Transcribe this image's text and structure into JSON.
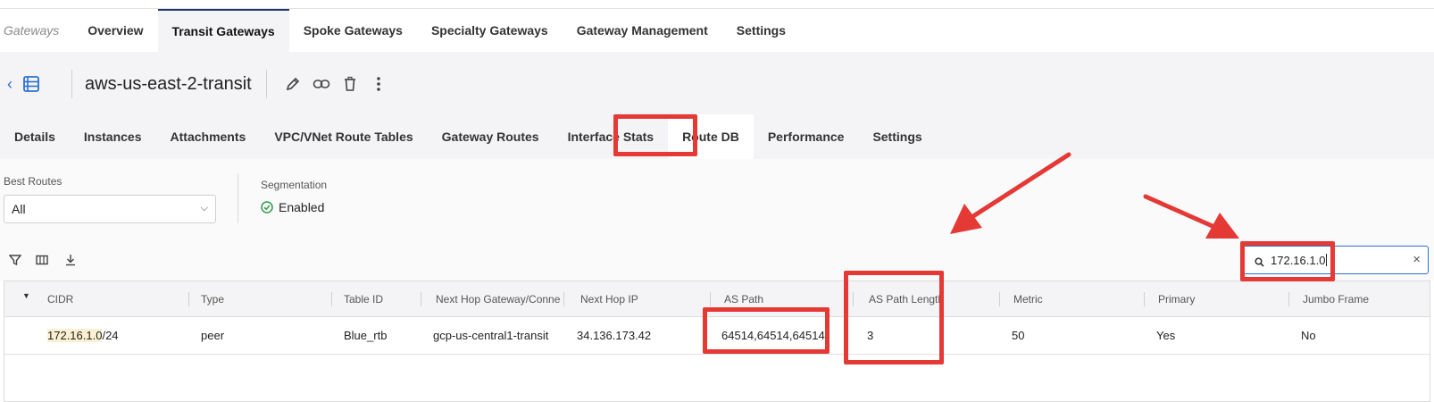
{
  "topnav": {
    "crumb": "Gateways",
    "tabs": [
      "Overview",
      "Transit Gateways",
      "Spoke Gateways",
      "Specialty Gateways",
      "Gateway Management",
      "Settings"
    ],
    "active_tab": "Transit Gateways"
  },
  "gateway": {
    "name": "aws-us-east-2-transit",
    "actions": [
      "edit-icon",
      "link-icon",
      "trash-icon",
      "more-vertical-icon"
    ]
  },
  "subtabs": {
    "items": [
      "Details",
      "Instances",
      "Attachments",
      "VPC/VNet Route Tables",
      "Gateway Routes",
      "Interface Stats",
      "Route DB",
      "Performance",
      "Settings"
    ],
    "active": "Route DB"
  },
  "filters": {
    "best_routes_label": "Best Routes",
    "best_routes_value": "All",
    "segmentation_label": "Segmentation",
    "segmentation_value": "Enabled"
  },
  "toolbar": {
    "icons": [
      "filter-icon",
      "columns-icon",
      "download-icon"
    ],
    "search_value": "172.16.1.0"
  },
  "table": {
    "columns": [
      "CIDR",
      "Type",
      "Table ID",
      "Next Hop Gateway/Connecti",
      "Next Hop IP",
      "AS Path",
      "AS Path Length",
      "Metric",
      "Primary",
      "Jumbo Frame"
    ],
    "rows": [
      {
        "cidr_match": "172.16.1.0",
        "cidr_rest": "/24",
        "type": "peer",
        "table_id": "Blue_rtb",
        "next_hop_gateway": "gcp-us-central1-transit",
        "next_hop_ip": "34.136.173.42",
        "as_path": "64514,64514,64514",
        "as_path_length": "3",
        "metric": "50",
        "primary": "Yes",
        "jumbo_frame": "No"
      }
    ]
  },
  "colors": {
    "accent": "#2a6fd6",
    "annotation_red": "#e53935",
    "search_highlight": "#fbf1d2",
    "success_green": "#2e9d4a"
  }
}
